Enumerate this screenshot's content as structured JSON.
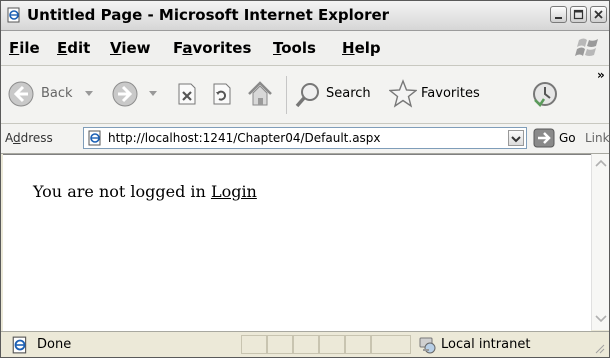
{
  "window": {
    "title": "Untitled Page - Microsoft Internet Explorer"
  },
  "menu": {
    "file": {
      "access": "F",
      "rest": "ile"
    },
    "edit": {
      "access": "E",
      "rest": "dit"
    },
    "view": {
      "access": "V",
      "rest": "iew"
    },
    "favorites": {
      "pre": "F",
      "access": "a",
      "rest": "vorites"
    },
    "tools": {
      "access": "T",
      "rest": "ools"
    },
    "help": {
      "access": "H",
      "rest": "elp"
    }
  },
  "toolbar": {
    "back_label": "Back",
    "search_label": "Search",
    "favorites_label": "Favorites",
    "overflow": "»"
  },
  "address": {
    "label_access": "d",
    "label_pre": "A",
    "label_rest": "dress",
    "url": "http://localhost:1241/Chapter04/Default.aspx",
    "go_label": "Go",
    "links_label": "Links",
    "overflow": "»"
  },
  "content": {
    "message": "You are not logged in ",
    "login_link": "Login"
  },
  "status": {
    "text": "Done",
    "zone": "Local intranet"
  },
  "icons": {
    "app": "ie-page-icon",
    "back": "back-arrow-icon",
    "forward": "forward-arrow-icon",
    "stop": "stop-icon",
    "refresh": "refresh-icon",
    "home": "home-icon",
    "search": "search-icon",
    "favorites": "favorites-star-icon",
    "history": "history-icon",
    "go": "go-arrow-icon",
    "status_page": "page-icon",
    "zone": "intranet-icon"
  }
}
